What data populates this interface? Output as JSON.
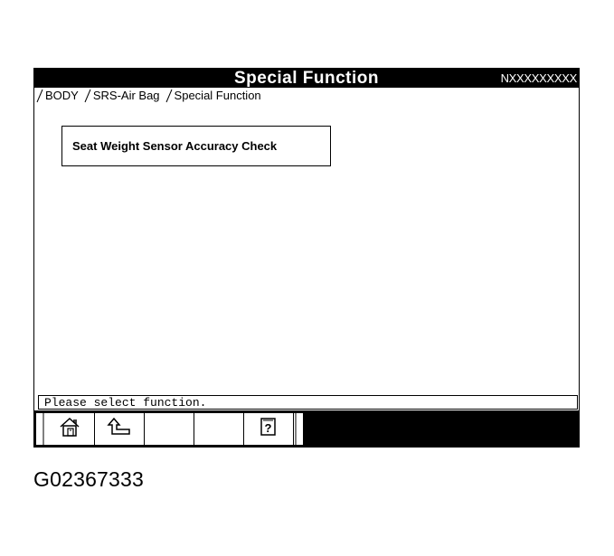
{
  "header": {
    "title": "Special Function",
    "vin": "NXXXXXXXXX"
  },
  "breadcrumb": [
    "BODY",
    "SRS-Air Bag",
    "Special Function"
  ],
  "functions": [
    {
      "label": "Seat Weight Sensor Accuracy Check"
    }
  ],
  "status": {
    "message": "Please select function."
  },
  "toolbar": {
    "buttons": [
      {
        "icon": "home-icon"
      },
      {
        "icon": "back-arrow-icon"
      },
      {
        "icon": "blank"
      },
      {
        "icon": "blank"
      },
      {
        "icon": "help-icon",
        "label": "?"
      }
    ]
  },
  "figure_id": "G02367333"
}
